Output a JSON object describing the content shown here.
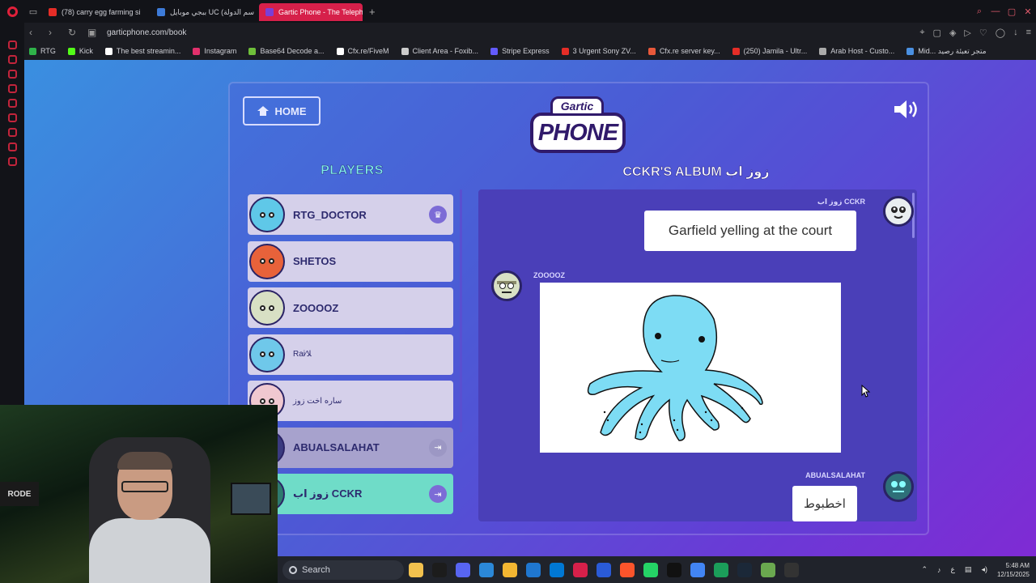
{
  "browser": {
    "tabs": [
      {
        "label": "(78) carry egg farming si",
        "color": "#e52d27",
        "active": false
      },
      {
        "label": "ببجي موبايل UC (اسم الدولة",
        "color": "#3d7bd8",
        "active": false
      },
      {
        "label": "Gartic Phone - The Teleph",
        "color": "#7a3fd6",
        "active": true
      }
    ],
    "url": "garticphone.com/book",
    "bookmarks": [
      {
        "label": "RTG",
        "color": "#2fb34a"
      },
      {
        "label": "Kick",
        "color": "#53fc18"
      },
      {
        "label": "The best streamin...",
        "color": "#ffffff"
      },
      {
        "label": "Instagram",
        "color": "#e1306c"
      },
      {
        "label": "Base64 Decode a...",
        "color": "#6fbf3a"
      },
      {
        "label": "Cfx.re/FiveM",
        "color": "#ffffff"
      },
      {
        "label": "Client Area - Foxib...",
        "color": "#cccccc"
      },
      {
        "label": "Stripe Express",
        "color": "#635bff"
      },
      {
        "label": "3 Urgent Sony ZV...",
        "color": "#e52d27"
      },
      {
        "label": "Cfx.re server key...",
        "color": "#e8583a"
      },
      {
        "label": "(250) Jamila - Ultr...",
        "color": "#e52d27"
      },
      {
        "label": "Arab Host - Custo...",
        "color": "#aaaaaa"
      },
      {
        "label": "Mid... متجر تعبئة رصيد",
        "color": "#4a90e2"
      }
    ]
  },
  "game": {
    "home_label": "HOME",
    "logo_top": "Gartic",
    "logo_main": "PHONE",
    "players_title": "PLAYERS",
    "album_title": "CCKR'S ALBUM زوز اب",
    "players": [
      {
        "name": "RTG_DOCTOR",
        "color": "#5fc8e8",
        "style": "normal",
        "badge": "♛",
        "small": false
      },
      {
        "name": "SHETOS",
        "color": "#e8623a",
        "style": "normal",
        "badge": "",
        "small": false
      },
      {
        "name": "ZOOOOZ",
        "color": "#d8e0c4",
        "style": "normal",
        "badge": "",
        "small": false
      },
      {
        "name": "Rai⁄ﻼ",
        "color": "#6fc8ea",
        "style": "normal",
        "badge": "",
        "small": true
      },
      {
        "name": "ساره اخت زوز",
        "color": "#f0c8d0",
        "style": "normal",
        "badge": "",
        "small": true
      },
      {
        "name": "ABUALSALAHAT",
        "color": "#3a3a80",
        "style": "dim",
        "badge": "⇥",
        "small": false
      },
      {
        "name": "زوز اب CCKR",
        "color": "#2e7a6e",
        "style": "self",
        "badge": "⇥",
        "small": false
      }
    ],
    "album": {
      "msg1_author": "زوز اب CCKR",
      "msg1_text": "Garfield yelling at the court",
      "msg2_author": "ZOOOOZ",
      "msg3_author": "ABUALSALAHAT",
      "msg3_text": "اخطبوط"
    }
  },
  "webcam": {
    "mic_label": "RODE"
  },
  "taskbar": {
    "search_placeholder": "Search",
    "icons": [
      "#f2c14e",
      "#1c1c1c",
      "#5865f2",
      "#2b88d8",
      "#f2b632",
      "#1f77d0",
      "#0078d4",
      "#d6204a",
      "#2a5bd7",
      "#fb542b",
      "#25d366",
      "#111111",
      "#4285f4",
      "#1b9e5a",
      "#1b2838",
      "#6aa84f",
      "#333333"
    ],
    "time": "5:48 AM",
    "date": "12/15/2025",
    "lang": "ع"
  }
}
